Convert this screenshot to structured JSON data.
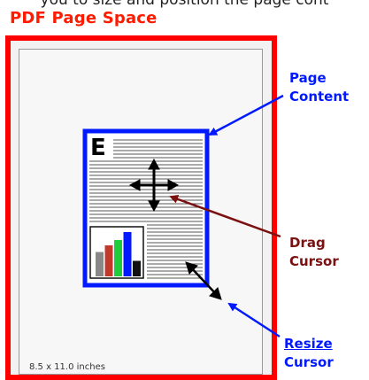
{
  "caption_cut": "you to size and position the page cont",
  "title": "PDF Page Space",
  "page_size_label": "8.5 x 11.0 inches",
  "doc_letter": "E",
  "callouts": {
    "page_content": [
      "Page",
      "Content"
    ],
    "drag_cursor": [
      "Drag",
      "Cursor"
    ],
    "resize_cursor": [
      "Resize",
      "Cursor"
    ]
  },
  "colors": {
    "title_red": "#ff1a00",
    "frame_red": "#ff0000",
    "content_blue": "#0019ff",
    "drag_maroon": "#7a1010",
    "bar_gray": "#888888",
    "bar_red": "#c0392b",
    "bar_green": "#1fcc3a",
    "bar_blue": "#0019ff",
    "bar_black": "#111111"
  },
  "chart_icon_bars": [
    {
      "color": "gray",
      "level": 0.55
    },
    {
      "color": "red",
      "level": 0.7
    },
    {
      "color": "green",
      "level": 0.82
    },
    {
      "color": "blue",
      "level": 1.0
    },
    {
      "color": "black",
      "level": 0.35
    }
  ]
}
